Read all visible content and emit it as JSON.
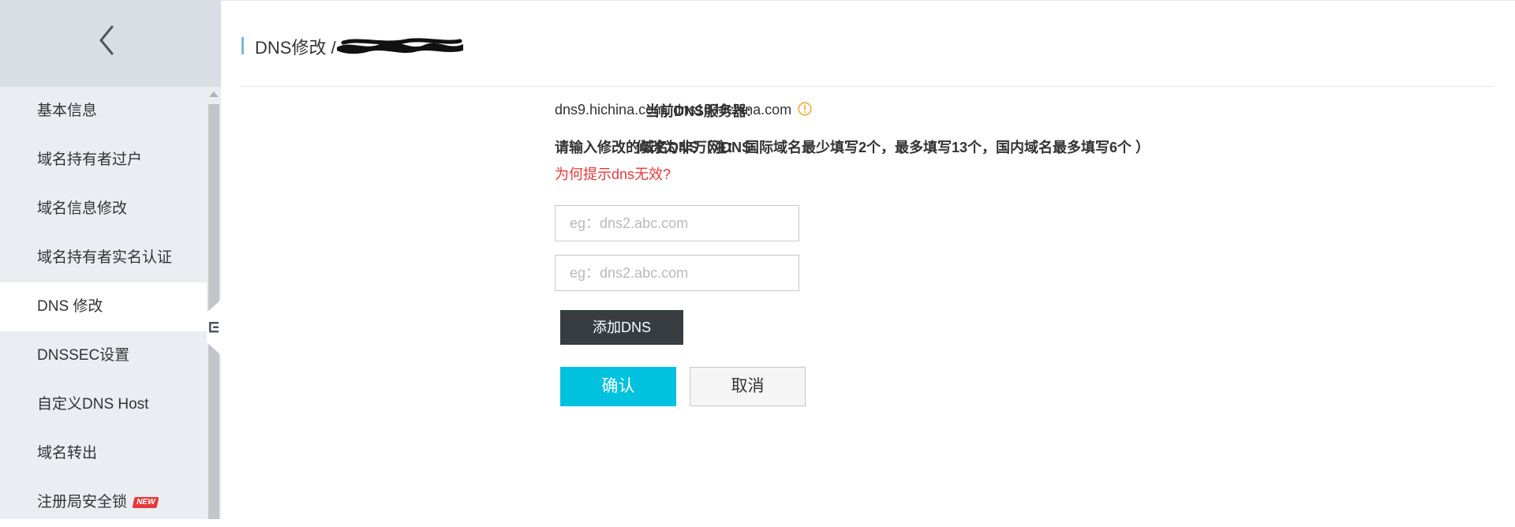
{
  "sidebar": {
    "items": [
      {
        "label": "基本信息"
      },
      {
        "label": "域名持有者过户"
      },
      {
        "label": "域名信息修改"
      },
      {
        "label": "域名持有者实名认证"
      },
      {
        "label": "DNS 修改",
        "active": true
      },
      {
        "label": "DNSSEC设置"
      },
      {
        "label": "自定义DNS Host"
      },
      {
        "label": "域名转出"
      },
      {
        "label": "注册局安全锁",
        "badge": "NEW"
      }
    ]
  },
  "header": {
    "title": "DNS修改 /"
  },
  "form": {
    "current_dns_label": "当前DNS服务器:",
    "current_dns_value": "dns9.hichina.com, dns10.hichina.com",
    "modify_label": "修改为非万网DNS",
    "instruction": "请输入修改的域名DNS（注： 国际域名最少填写2个，最多填写13个，国内域名最多填写6个 ）",
    "help_link": "为何提示dns无效?",
    "inputs": [
      {
        "value": "",
        "placeholder": "eg：dns2.abc.com"
      },
      {
        "value": "",
        "placeholder": "eg：dns2.abc.com"
      }
    ],
    "add_button": "添加DNS",
    "confirm_button": "确认",
    "cancel_button": "取消"
  },
  "colors": {
    "accent": "#00c1de",
    "dark_button": "#373d41",
    "link_red": "#e4393c",
    "warning": "#f5a623",
    "sidebar_bg": "#eaedf1"
  },
  "icons": [
    "chevron-left-icon",
    "warning-icon",
    "collapse-sidebar-icon",
    "scroll-up-icon"
  ]
}
